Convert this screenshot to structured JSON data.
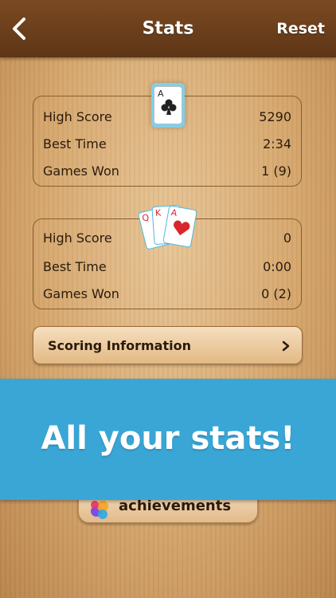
{
  "header": {
    "title": "Stats",
    "reset_label": "Reset"
  },
  "panels": [
    {
      "icon": "ace-of-clubs-card-icon",
      "rows": [
        {
          "label": "High Score",
          "value": "5290"
        },
        {
          "label": "Best Time",
          "value": "2:34"
        },
        {
          "label": "Games Won",
          "value": "1 (9)"
        }
      ]
    },
    {
      "icon": "heart-cards-fan-icon",
      "rows": [
        {
          "label": "High Score",
          "value": "0"
        },
        {
          "label": "Best Time",
          "value": "0:00"
        },
        {
          "label": "Games Won",
          "value": "0 (2)"
        }
      ]
    }
  ],
  "cards": {
    "single": {
      "rank": "A"
    },
    "fan": [
      {
        "rank": "Q"
      },
      {
        "rank": "K"
      },
      {
        "rank": "A"
      }
    ]
  },
  "scoring_button": {
    "label": "Scoring Information"
  },
  "banner": {
    "text": "All your stats!"
  },
  "achievements_button": {
    "label": "achievements"
  },
  "colors": {
    "topbar": "#6b3f1b",
    "banner": "#3aa6d6",
    "text": "#2a1a0c",
    "heart_red": "#d9262a"
  }
}
